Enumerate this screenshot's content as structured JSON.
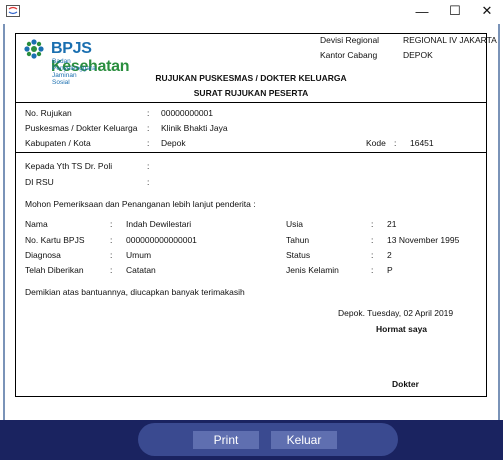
{
  "window": {
    "min": "—",
    "max": "☐",
    "close": "✕"
  },
  "logo": {
    "brand1": "BPJS",
    "brand2": "Kesehatan",
    "tagline": "Badan Penyelenggara Jaminan Sosial"
  },
  "header": {
    "devisi_label": "Devisi Regional",
    "devisi_value": "REGIONAL IV JAKARTA",
    "kantor_label": "Kantor Cabang",
    "kantor_value": "DEPOK"
  },
  "title": {
    "line1": "RUJUKAN PUSKESMAS / DOKTER KELUARGA",
    "line2": "SURAT RUJUKAN PESERTA"
  },
  "rujukan": {
    "no_label": "No. Rujukan",
    "no_value": "00000000001",
    "puskesmas_label": "Puskesmas / Dokter Keluarga",
    "puskesmas_value": "Klinik Bhakti Jaya",
    "kab_label": "Kabupaten / Kota",
    "kab_value": "Depok",
    "kode_label": "Kode",
    "kode_value": "16451"
  },
  "kepada": {
    "line1_label": "Kepada Yth TS Dr. Poli",
    "line2_label": "DI RSU"
  },
  "mohon": "Mohon Pemeriksaan dan Penanganan lebih lanjut penderita :",
  "pasien": {
    "nama_label": "Nama",
    "nama_value": "Indah Dewilestari",
    "kartu_label": "No. Kartu BPJS",
    "kartu_value": "000000000000001",
    "diagnosa_label": "Diagnosa",
    "diagnosa_value": "Umum",
    "diberikan_label": "Telah Diberikan",
    "diberikan_value": "Catatan",
    "usia_label": "Usia",
    "usia_value": "21",
    "tahun_label": "Tahun",
    "tahun_value": "13 November 1995",
    "status_label": "Status",
    "status_value": "2",
    "jk_label": "Jenis Kelamin",
    "jk_value": "P"
  },
  "colon": ":",
  "closing": "Demikian atas bantuannya, diucapkan banyak terimakasih",
  "sign": {
    "place_date": "Depok.  Tuesday, 02 April 2019",
    "hormat": "Hormat saya",
    "name": "Dokter"
  },
  "buttons": {
    "print": "Print",
    "keluar": "Keluar"
  }
}
